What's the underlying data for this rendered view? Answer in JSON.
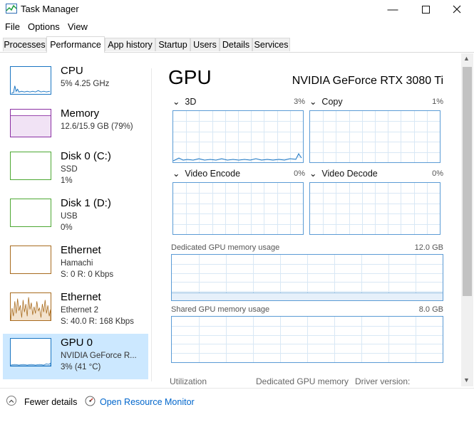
{
  "window": {
    "title": "Task Manager"
  },
  "menu": [
    "File",
    "Options",
    "View"
  ],
  "tabs": [
    "Processes",
    "Performance",
    "App history",
    "Startup",
    "Users",
    "Details",
    "Services"
  ],
  "active_tab": "Performance",
  "sidebar": [
    {
      "title": "CPU",
      "sub1": "5% 4.25 GHz",
      "sub2": "",
      "color": "#1a75c2"
    },
    {
      "title": "Memory",
      "sub1": "12.6/15.9 GB (79%)",
      "sub2": "",
      "color": "#8b2fa3"
    },
    {
      "title": "Disk 0 (C:)",
      "sub1": "SSD",
      "sub2": "1%",
      "color": "#4da833"
    },
    {
      "title": "Disk 1 (D:)",
      "sub1": "USB",
      "sub2": "0%",
      "color": "#4da833"
    },
    {
      "title": "Ethernet",
      "sub1": "Hamachi",
      "sub2": "S: 0 R: 0 Kbps",
      "color": "#a86b1e"
    },
    {
      "title": "Ethernet",
      "sub1": "Ethernet 2",
      "sub2": "S: 40.0 R: 168 Kbps",
      "color": "#a86b1e"
    },
    {
      "title": "GPU 0",
      "sub1": "NVIDIA GeForce R...",
      "sub2": "3% (41 °C)",
      "color": "#1a75c2"
    }
  ],
  "selected_sidebar_index": 6,
  "main": {
    "title": "GPU",
    "model": "NVIDIA GeForce RTX 3080 Ti",
    "graphs": [
      {
        "label": "3D",
        "value": "3%"
      },
      {
        "label": "Copy",
        "value": "1%"
      },
      {
        "label": "Video Encode",
        "value": "0%"
      },
      {
        "label": "Video Decode",
        "value": "0%"
      }
    ],
    "dedicated_label": "Dedicated GPU memory usage",
    "dedicated_value": "12.0 GB",
    "shared_label": "Shared GPU memory usage",
    "shared_value": "8.0 GB",
    "stats": [
      "Utilization",
      "Dedicated GPU memory",
      "Driver version:"
    ]
  },
  "footer": {
    "fewer_details": "Fewer details",
    "resource_monitor": "Open Resource Monitor"
  },
  "colors": {
    "gpu_line": "#1a75c2",
    "graph_border": "#5b9bd5",
    "grid": "#d9e8f5",
    "selected_bg": "#cce8ff",
    "link": "#0066cc"
  }
}
